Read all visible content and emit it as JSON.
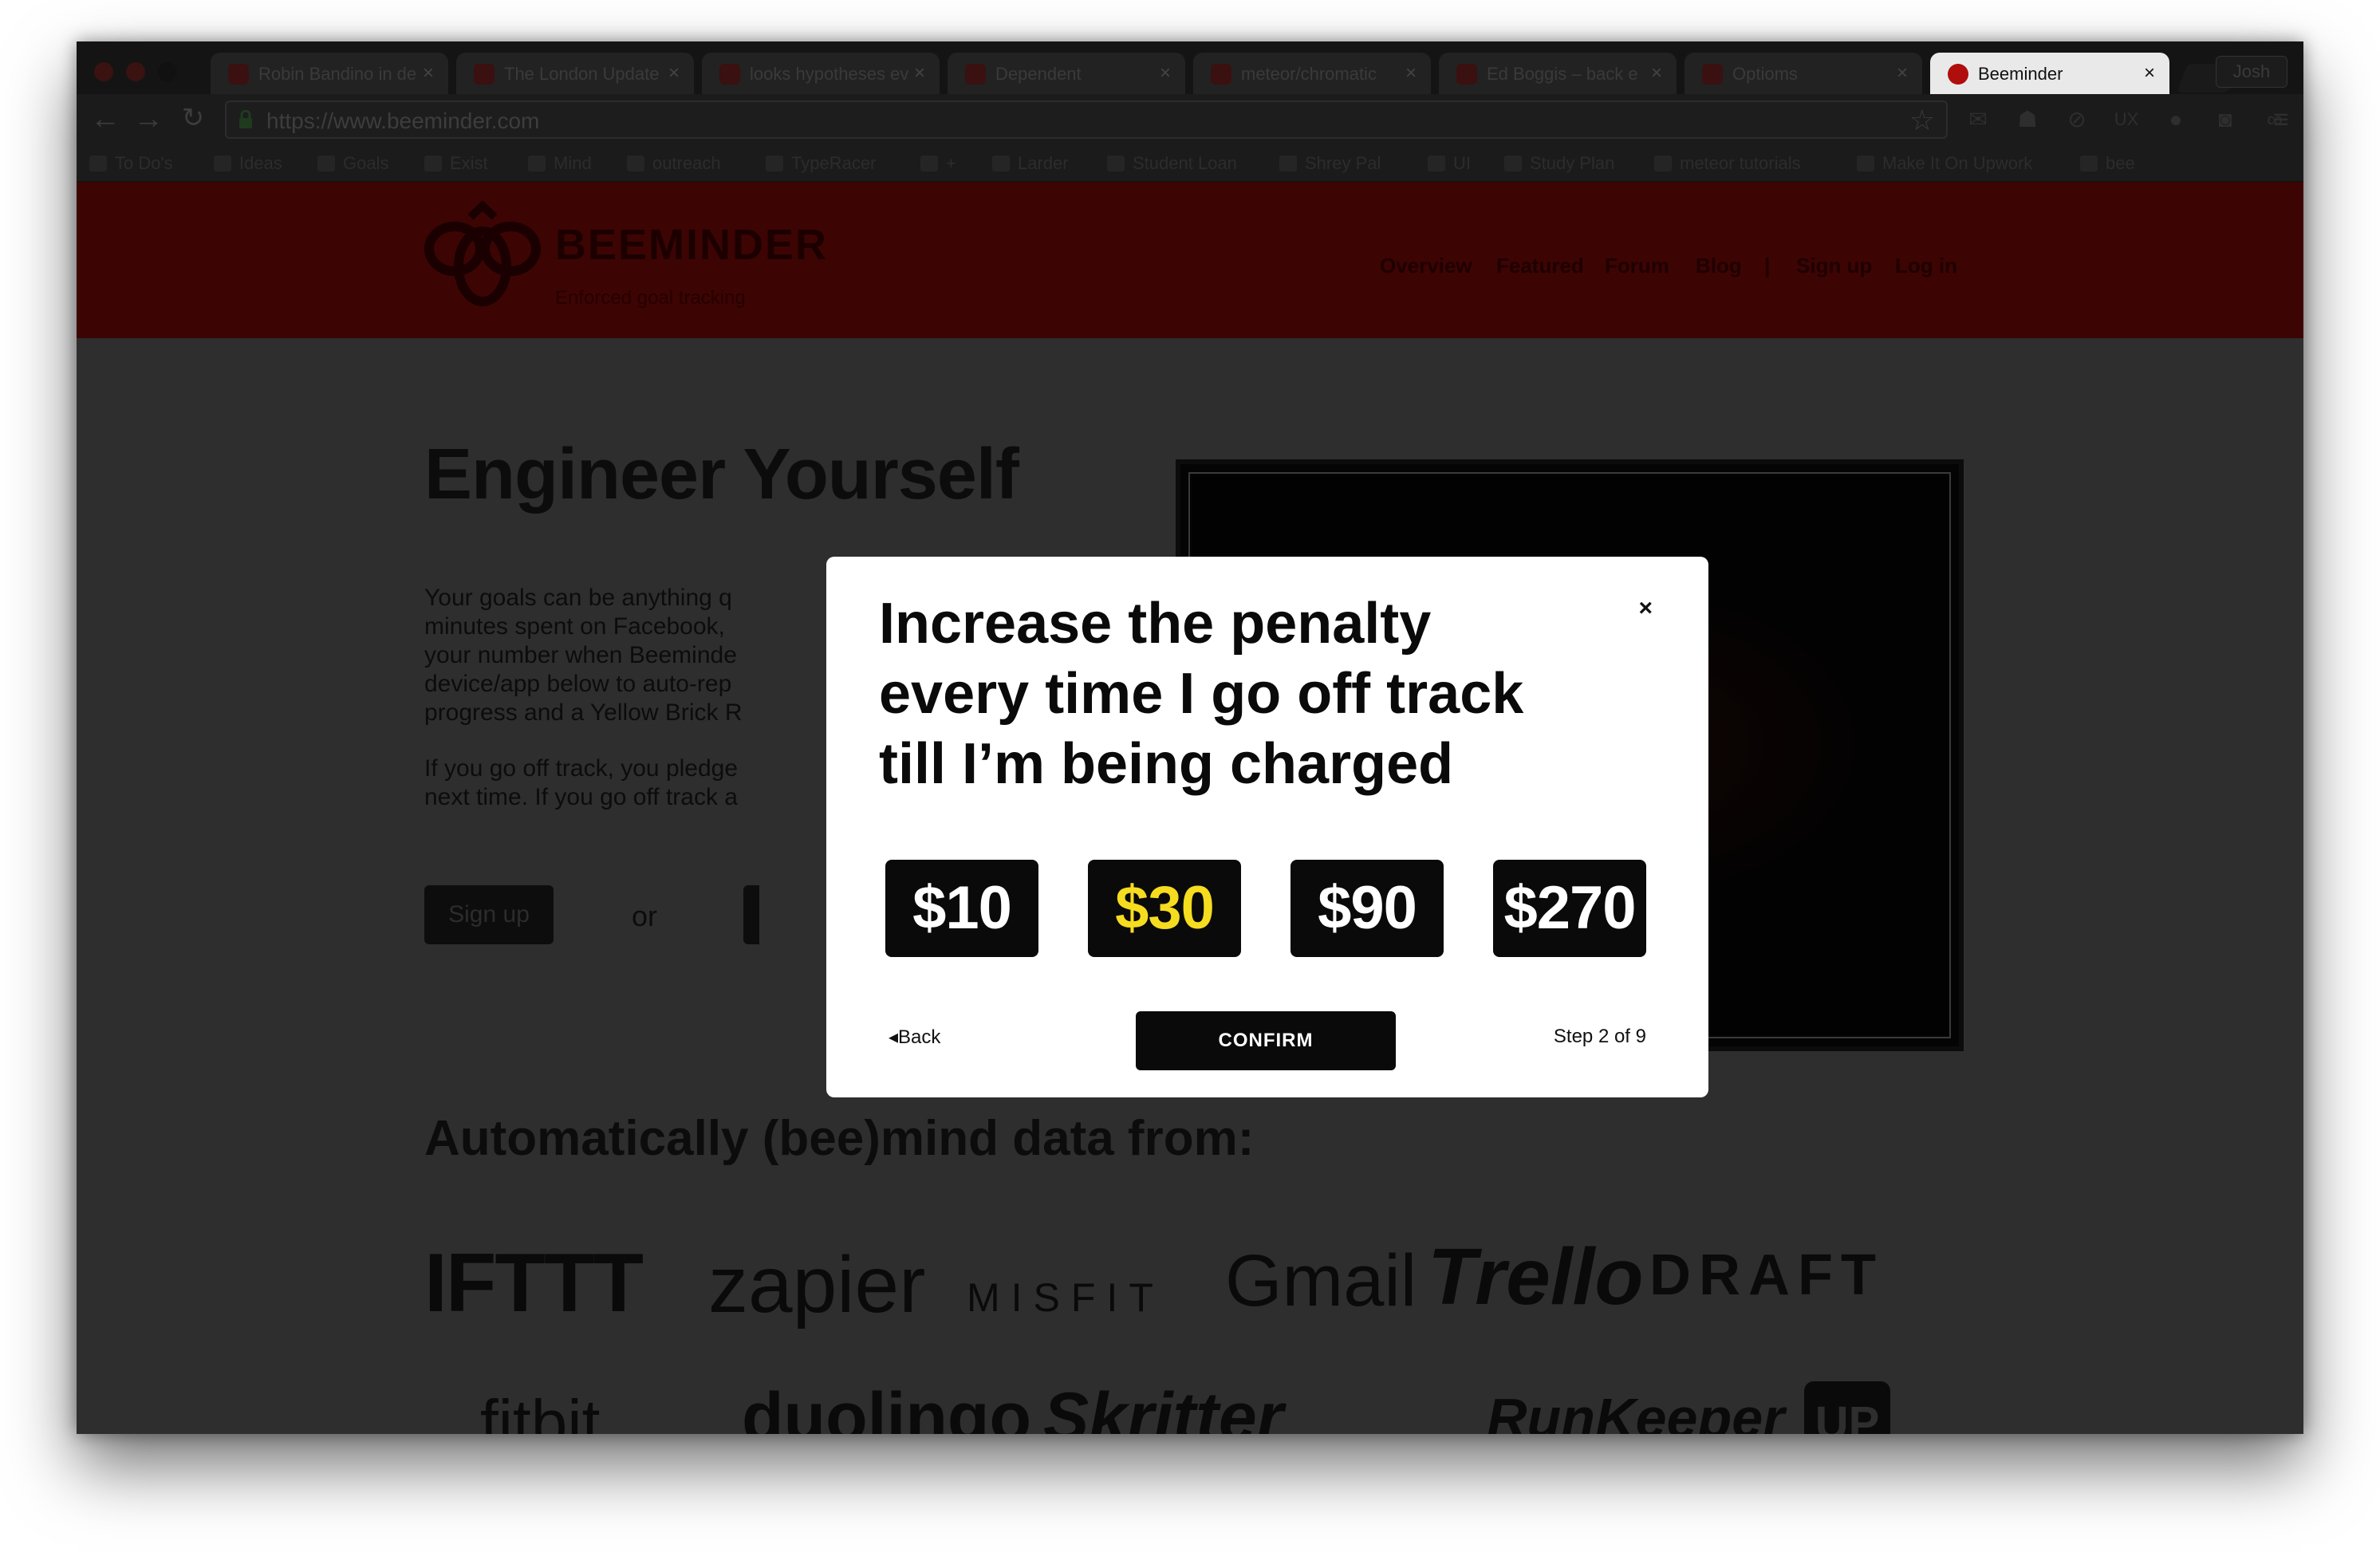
{
  "browser": {
    "tabs": [
      {
        "label": "Robin Bandino in de"
      },
      {
        "label": "The London Update"
      },
      {
        "label": "looks hypotheses ev"
      },
      {
        "label": "Dependent"
      },
      {
        "label": "meteor/chromatic"
      },
      {
        "label": "Ed Boggis – back e"
      },
      {
        "label": "Optioms"
      },
      {
        "label": "Beeminder"
      }
    ],
    "user_button": "Josh",
    "url": "https://www.beeminder.com",
    "bookmarks": [
      "To Do's",
      "Ideas",
      "Goals",
      "Exist",
      "Mind",
      "outreach",
      "TypeRacer",
      "+",
      "Larder",
      "Student Loan",
      "Shrey Pal",
      "UI",
      "Study Plan",
      "meteor tutorials",
      "Make It On Upwork",
      "bee"
    ]
  },
  "site": {
    "logo_text": "BEEMINDER",
    "logo_tagline": "Enforced goal tracking",
    "nav": [
      "Overview",
      "Featured",
      "Forum",
      "Blog",
      "|",
      "Sign up",
      "Log in"
    ],
    "headline": "Engineer Yourself",
    "para1": "Your goals can be anything q\nminutes spent on Facebook,\nyour number when Beeminde\ndevice/app below to auto-rep\nprogress and a Yellow Brick R",
    "para2": "If you go off track, you pledge\nnext time. If you go off track a",
    "signup_label": "Sign up",
    "or_label": "or",
    "integrations_heading": "Automatically (bee)mind data from:",
    "integrations": [
      "IFTTT",
      "zapier",
      "MISFIT",
      "Gmail",
      "Trello",
      "DRAFT",
      "fitbit",
      "duolingo",
      "Skritter",
      "RunKeeper",
      "UP"
    ]
  },
  "dialog": {
    "title": "Increase the penalty every time I go off track till I’m being charged",
    "close": "×",
    "amounts": [
      "$10",
      "$30",
      "$90",
      "$270"
    ],
    "selected_amount": "$30",
    "back_label": "Back",
    "confirm_label": "CONFIRM",
    "step_label": "Step 2 of 9"
  },
  "colors": {
    "header_red": "#3d0404",
    "accent_yellow": "#f5dc1f",
    "button_black": "#0a0a0a"
  }
}
